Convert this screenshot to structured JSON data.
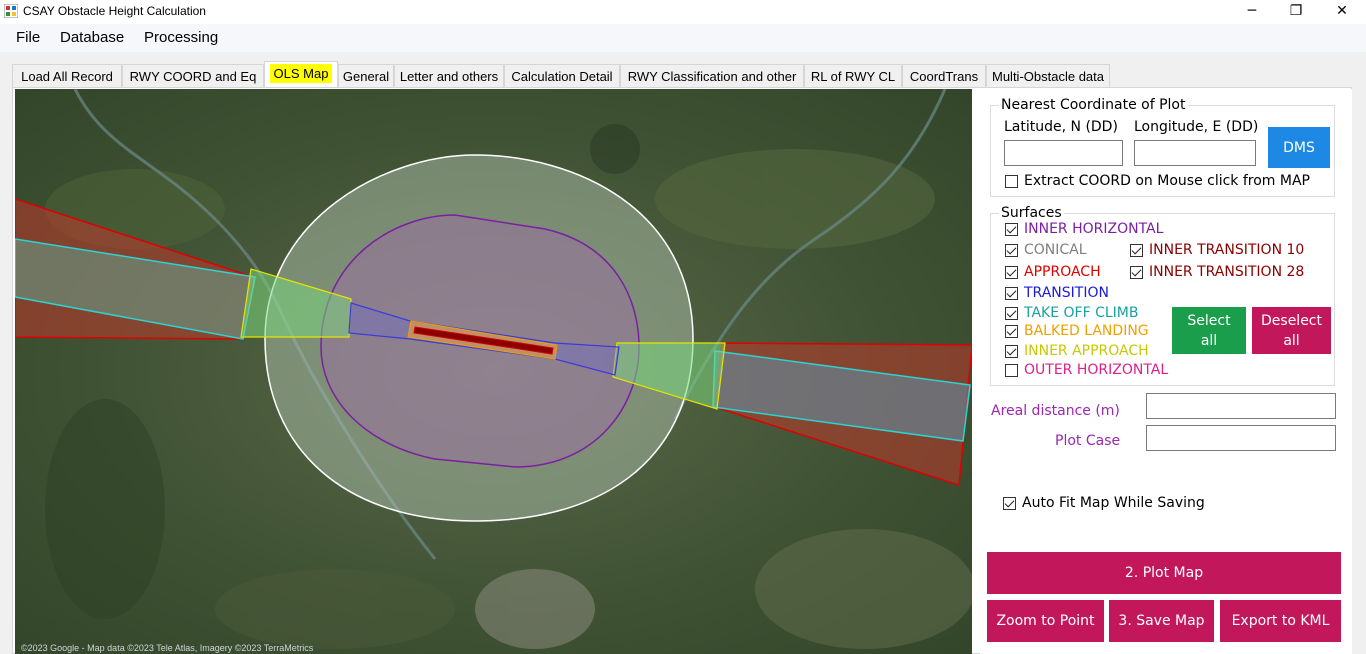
{
  "window": {
    "title": "CSAY Obstacle Height Calculation",
    "controls": {
      "minimize": "─",
      "maximize": "❐",
      "close": "✕"
    }
  },
  "menu": {
    "items": [
      "File",
      "Database",
      "Processing"
    ]
  },
  "tabs": [
    {
      "label": "Load All Record",
      "active": false
    },
    {
      "label": "RWY COORD and Eq",
      "active": false
    },
    {
      "label": "OLS Map",
      "active": true
    },
    {
      "label": "General",
      "active": false
    },
    {
      "label": "Letter and others",
      "active": false
    },
    {
      "label": "Calculation Detail",
      "active": false
    },
    {
      "label": "RWY Classification and other",
      "active": false
    },
    {
      "label": "RL of RWY CL",
      "active": false
    },
    {
      "label": "CoordTrans",
      "active": false
    },
    {
      "label": "Multi-Obstacle data",
      "active": false
    }
  ],
  "map": {
    "copyright": "©2023 Google - Map data ©2023 Tele Atlas, Imagery ©2023 TerraMetrics"
  },
  "nearest_coord": {
    "title": "Nearest Coordinate of Plot",
    "lat_label": "Latitude, N (DD)",
    "lon_label": "Longitude, E (DD)",
    "lat_value": "",
    "lon_value": "",
    "dms_button": "DMS",
    "extract_label": "Extract COORD on Mouse click from MAP",
    "extract_checked": false
  },
  "surfaces": {
    "title": "Surfaces",
    "items": {
      "inner_horizontal": {
        "label": "INNER HORIZONTAL",
        "checked": true,
        "color": "#7b1fa2"
      },
      "conical": {
        "label": "CONICAL",
        "checked": true,
        "color": "#808080"
      },
      "inner_transition_10": {
        "label": "INNER TRANSITION 10",
        "checked": true,
        "color": "#8b0000"
      },
      "approach": {
        "label": "APPROACH",
        "checked": true,
        "color": "#e00000"
      },
      "inner_transition_28": {
        "label": "INNER TRANSITION 28",
        "checked": true,
        "color": "#8b0000"
      },
      "transition": {
        "label": "TRANSITION",
        "checked": true,
        "color": "#1a1adc"
      },
      "take_off_climb": {
        "label": "TAKE OFF CLIMB",
        "checked": true,
        "color": "#1aa0a0"
      },
      "balked_landing": {
        "label": "BALKED LANDING",
        "checked": true,
        "color": "#f0a000"
      },
      "inner_approach": {
        "label": "INNER APPROACH",
        "checked": true,
        "color": "#c8c800"
      },
      "outer_horizontal": {
        "label": "OUTER HORIZONTAL",
        "checked": false,
        "color": "#e0208a"
      }
    },
    "select_all": "Select all",
    "deselect_all": "Deselect all"
  },
  "areal_distance": {
    "label": "Areal distance (m)",
    "value": ""
  },
  "plot_case": {
    "label": "Plot Case",
    "value": ""
  },
  "auto_fit": {
    "label": "Auto Fit Map While Saving",
    "checked": true
  },
  "buttons": {
    "plot_map": "2. Plot Map",
    "zoom_to_point": "Zoom to Point",
    "save_map": "3. Save Map",
    "export_kml": "Export to KML"
  },
  "colors": {
    "accent_blue": "#1e88e5",
    "button_crimson": "#c2185b",
    "label_purple": "#9c27b0"
  }
}
